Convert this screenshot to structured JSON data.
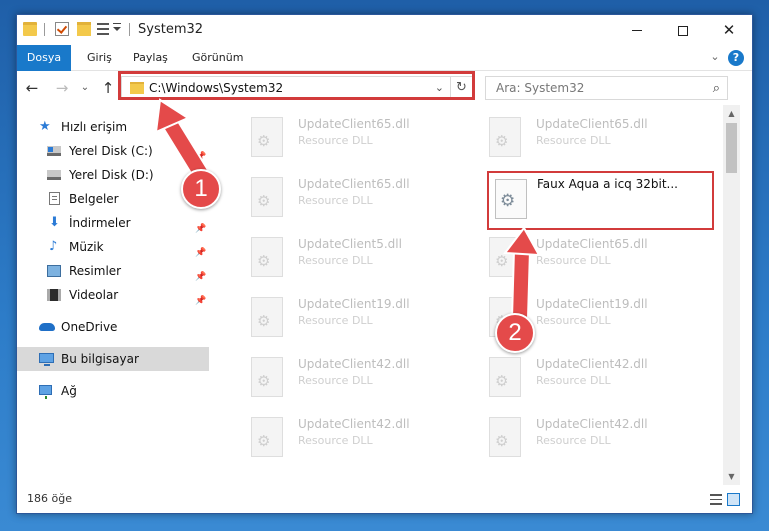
{
  "window": {
    "title": "System32",
    "minimize_glyph": "",
    "close_glyph": "✕"
  },
  "ribbon": {
    "tabs": [
      "Dosya",
      "Giriş",
      "Paylaş",
      "Görünüm"
    ],
    "help": "?"
  },
  "address": {
    "path": "C:\\Windows\\System32",
    "search_placeholder": "Ara: System32"
  },
  "sidebar": {
    "items": [
      {
        "label": "Hızlı erişim",
        "icon": "star-icon",
        "pinned": false
      },
      {
        "label": "Yerel Disk (C:)",
        "icon": "drive-c-icon",
        "pinned": true
      },
      {
        "label": "Yerel Disk (D:)",
        "icon": "drive-d-icon",
        "pinned": false
      },
      {
        "label": "Belgeler",
        "icon": "documents-icon",
        "pinned": true
      },
      {
        "label": "İndirmeler",
        "icon": "downloads-icon",
        "pinned": true
      },
      {
        "label": "Müzik",
        "icon": "music-icon",
        "pinned": true
      },
      {
        "label": "Resimler",
        "icon": "pictures-icon",
        "pinned": true
      },
      {
        "label": "Videolar",
        "icon": "videos-icon",
        "pinned": true
      },
      {
        "label": "OneDrive",
        "icon": "onedrive-icon",
        "pinned": false
      },
      {
        "label": "Bu bilgisayar",
        "icon": "this-pc-icon",
        "pinned": false
      },
      {
        "label": "Ağ",
        "icon": "network-icon",
        "pinned": false
      }
    ]
  },
  "files": {
    "left_column": [
      {
        "name": "UpdateClient65.dll",
        "desc": "Resource DLL"
      },
      {
        "name": "UpdateClient65.dll",
        "desc": "Resource DLL"
      },
      {
        "name": "UpdateClient5.dll",
        "desc": "Resource DLL"
      },
      {
        "name": "UpdateClient19.dll",
        "desc": "Resource DLL"
      },
      {
        "name": "UpdateClient42.dll",
        "desc": "Resource DLL"
      },
      {
        "name": "UpdateClient42.dll",
        "desc": "Resource DLL"
      }
    ],
    "right_column": [
      {
        "name": "UpdateClient65.dll",
        "desc": "Resource DLL"
      },
      {
        "name": "Faux Aqua a icq 32bit...",
        "desc": "",
        "focused": true
      },
      {
        "name": "UpdateClient65.dll",
        "desc": "Resource DLL"
      },
      {
        "name": "UpdateClient19.dll",
        "desc": "Resource DLL"
      },
      {
        "name": "UpdateClient42.dll",
        "desc": "Resource DLL"
      },
      {
        "name": "UpdateClient42.dll",
        "desc": "Resource DLL"
      }
    ]
  },
  "status": {
    "count": "186 öğe"
  },
  "annotations": {
    "badge_1": "1",
    "badge_2": "2",
    "color": "#d23b3b"
  },
  "colors": {
    "accent": "#1979ca",
    "annotation_red": "#d23b3b"
  }
}
